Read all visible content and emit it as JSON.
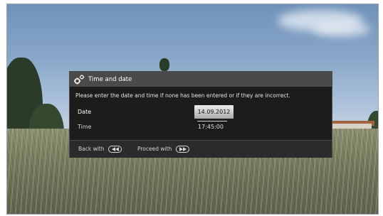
{
  "dialog": {
    "title": "Time and date",
    "title_icon": "gears-icon",
    "message": "Please enter the date and time if none has been entered or if they are incorrect.",
    "rows": [
      {
        "label": "Date",
        "value": "14.09.2012"
      },
      {
        "label": "Time",
        "value": "17:45:00"
      }
    ],
    "footer": {
      "back_label": "Back with",
      "back_icon": "rewind-button-icon",
      "proceed_label": "Proceed with",
      "proceed_icon": "fast-forward-button-icon"
    }
  },
  "colors": {
    "dialog_background": "#1c1c1c",
    "header_background": "#4a4a4a",
    "footer_background": "#2b2b2b",
    "date_field_highlight": "#d0d0d0"
  }
}
